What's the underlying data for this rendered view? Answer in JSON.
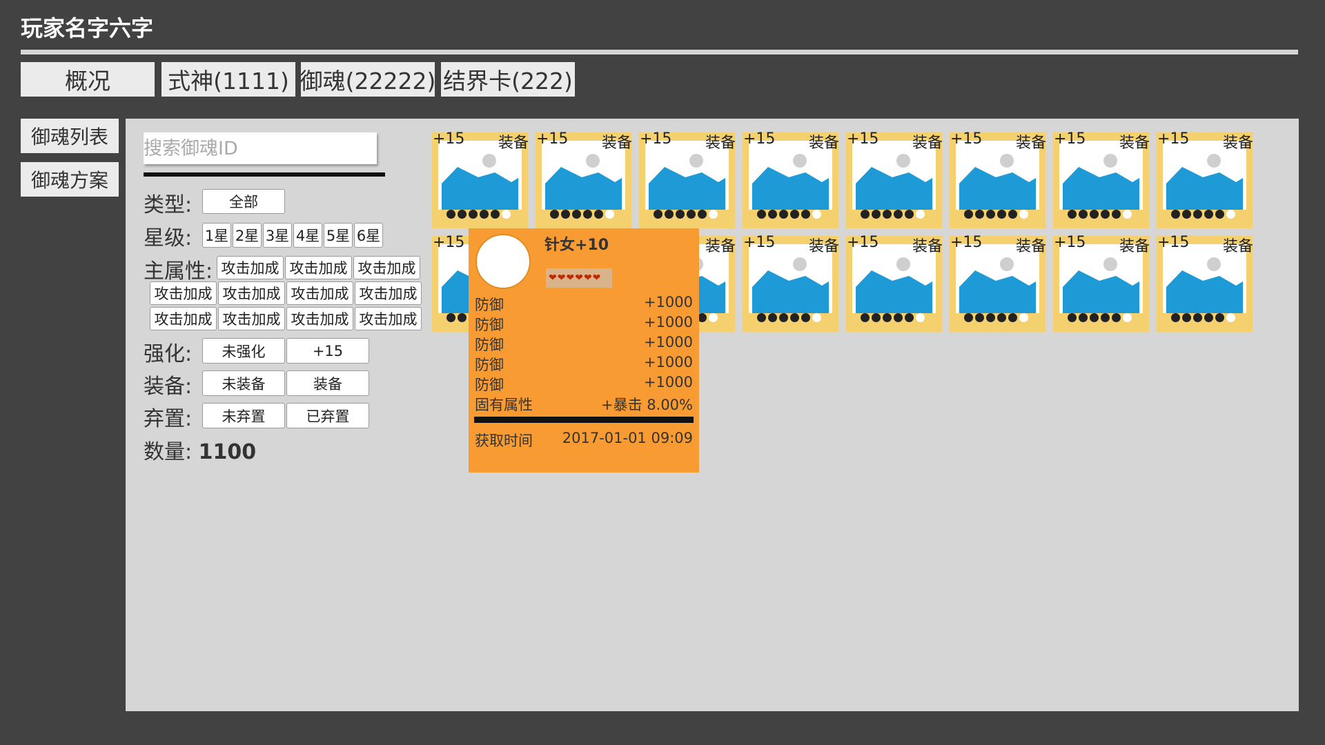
{
  "player_name": "玩家名字六字",
  "tabs": [
    "概况",
    "式神(1111)",
    "御魂(22222)",
    "结界卡(222)"
  ],
  "sidenav": [
    "御魂列表",
    "御魂方案"
  ],
  "search": {
    "placeholder": "搜索御魂ID"
  },
  "filters": {
    "type": {
      "label": "类型:",
      "options": [
        "全部"
      ]
    },
    "star": {
      "label": "星级:",
      "options": [
        "1星",
        "2星",
        "3星",
        "4星",
        "5星",
        "6星"
      ]
    },
    "main_attr": {
      "label": "主属性:",
      "options": [
        "攻击加成",
        "攻击加成",
        "攻击加成",
        "攻击加成",
        "攻击加成",
        "攻击加成",
        "攻击加成",
        "攻击加成",
        "攻击加成",
        "攻击加成",
        "攻击加成"
      ]
    },
    "enhance": {
      "label": "强化:",
      "options": [
        "未强化",
        "+15"
      ]
    },
    "equip": {
      "label": "装备:",
      "options": [
        "未装备",
        "装备"
      ]
    },
    "discard": {
      "label": "弃置:",
      "options": [
        "未弃置",
        "已弃置"
      ]
    },
    "count": {
      "label": "数量:",
      "value": "1100"
    }
  },
  "cards": {
    "level": "+15",
    "equip": "装备",
    "stars": 5,
    "max_stars": 6,
    "rows": 2,
    "cols": 8
  },
  "tooltip": {
    "name": "针女+10",
    "stars": 6,
    "stats": [
      {
        "name": "防御",
        "value": "+1000"
      },
      {
        "name": "防御",
        "value": "+1000"
      },
      {
        "name": "防御",
        "value": "+1000"
      },
      {
        "name": "防御",
        "value": "+1000"
      },
      {
        "name": "防御",
        "value": "+1000"
      },
      {
        "name": "固有属性",
        "value": "+暴击 8.00%"
      }
    ],
    "acquire_label": "获取时间",
    "acquire_time": "2017-01-01 09:09"
  },
  "colors": {
    "background": "#424242",
    "panel": "#d6d6d6",
    "card_border": "#f5d06e",
    "card_image": "#1e9ad6",
    "tooltip": "#f99b33"
  }
}
